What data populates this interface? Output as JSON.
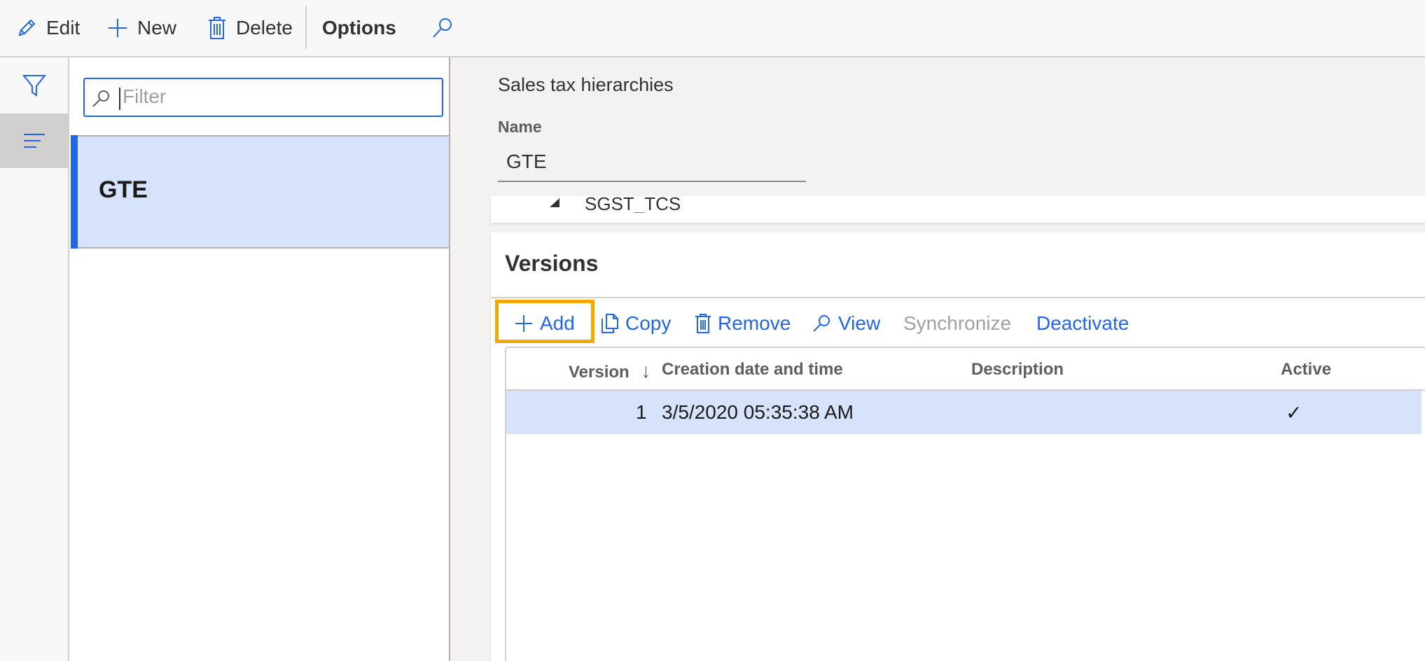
{
  "action_bar": {
    "edit_label": "Edit",
    "new_label": "New",
    "delete_label": "Delete",
    "options_label": "Options"
  },
  "list": {
    "filter_placeholder": "Filter",
    "items": [
      {
        "label": "GTE",
        "selected": true
      }
    ]
  },
  "details": {
    "title": "Sales tax hierarchies",
    "name_label": "Name",
    "name_value": "GTE",
    "tree_node_label": "SGST_TCS"
  },
  "versions": {
    "title": "Versions",
    "toolbar": {
      "add_label": "Add",
      "copy_label": "Copy",
      "remove_label": "Remove",
      "view_label": "View",
      "synchronize_label": "Synchronize",
      "deactivate_label": "Deactivate"
    },
    "columns": {
      "version": "Version",
      "sort_indicator": "↓",
      "creation": "Creation date and time",
      "description": "Description",
      "active": "Active"
    },
    "rows": [
      {
        "version": "1",
        "creation": "3/5/2020 05:35:38 AM",
        "description": "",
        "active": "✓"
      }
    ]
  },
  "colors": {
    "accent": "#2266e3",
    "selection": "#d6e3fb",
    "highlight": "#f2a900",
    "disabled": "#a19f9d"
  }
}
